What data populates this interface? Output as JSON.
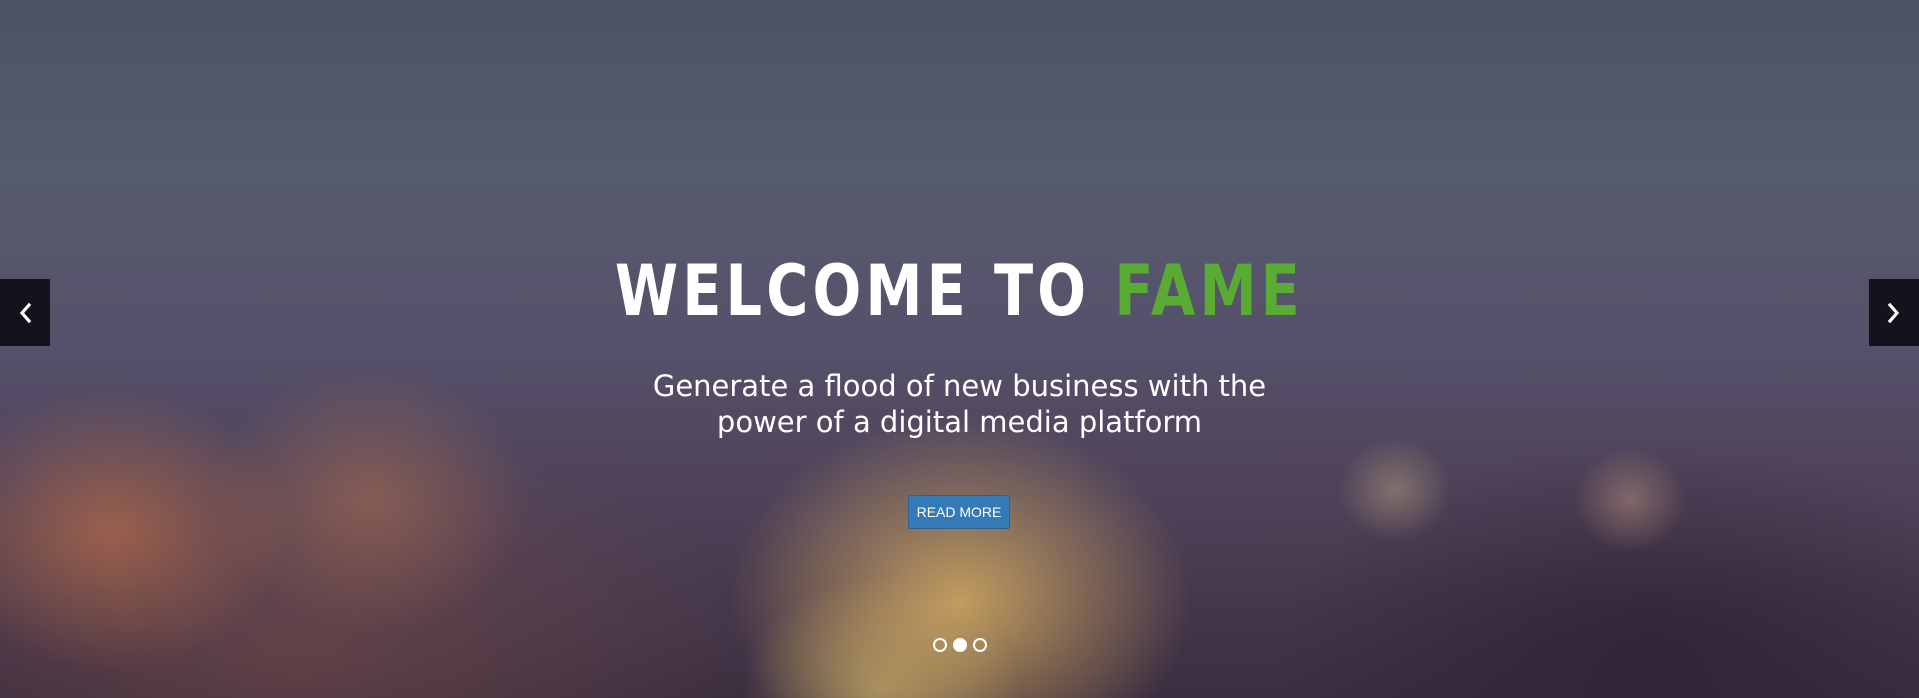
{
  "hero": {
    "title_main": "WELCOME TO ",
    "title_accent": "FAME",
    "subtitle_line1": "Generate a flood of new business with the",
    "subtitle_line2": "power of a digital media platform",
    "button_label": "READ MORE",
    "accent_color": "#5aab34",
    "button_color": "#337ab7"
  },
  "carousel": {
    "prev_icon": "chevron-left-icon",
    "next_icon": "chevron-right-icon",
    "slide_count": 3,
    "active_index": 1
  }
}
